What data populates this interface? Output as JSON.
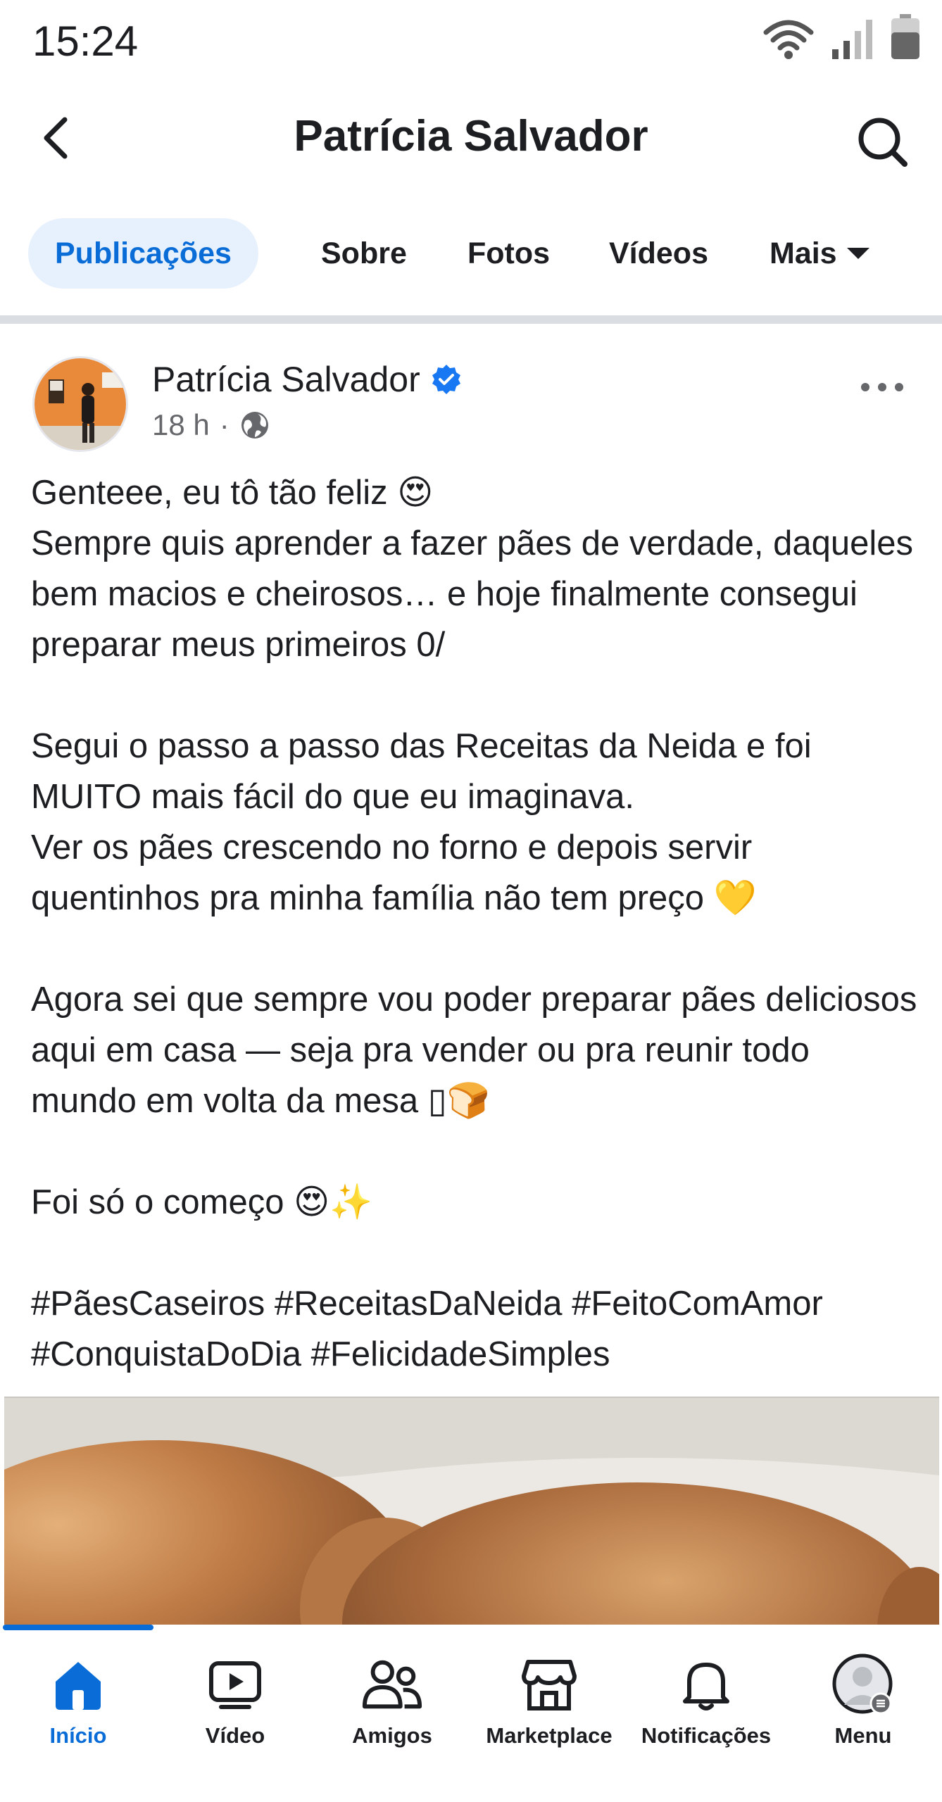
{
  "status_bar": {
    "time": "15:24"
  },
  "header": {
    "title": "Patrícia Salvador"
  },
  "tabs": [
    {
      "label": "Publicações",
      "active": true
    },
    {
      "label": "Sobre",
      "active": false
    },
    {
      "label": "Fotos",
      "active": false
    },
    {
      "label": "Vídeos",
      "active": false
    },
    {
      "label": "Mais",
      "active": false
    }
  ],
  "post": {
    "author": "Patrícia Salvador",
    "verified": true,
    "time": "18 h",
    "separator": "·",
    "audience_icon": "globe-icon",
    "paragraphs": [
      [
        "Genteee, eu tô tão feliz 😍",
        "Sempre quis aprender a fazer pães de verdade, daqueles bem macios e cheirosos… e hoje finalmente consegui preparar meus primeiros 0/"
      ],
      [
        "Segui o passo a passo das Receitas da Neida e foi MUITO mais fácil do que eu imaginava.",
        "Ver os pães crescendo no forno e depois servir quentinhos pra minha família não tem preço 💛"
      ],
      [
        "Agora sei que sempre vou poder preparar pães deliciosos aqui em casa — seja pra vender ou pra reunir todo mundo em volta da mesa ▯🍞"
      ],
      [
        "Foi só o começo 😍✨"
      ],
      [
        "#PãesCaseiros #ReceitasDaNeida #FeitoComAmor #ConquistaDoDia #FelicidadeSimples"
      ]
    ]
  },
  "bottom_nav": [
    {
      "label": "Início",
      "icon": "home-icon",
      "active": true
    },
    {
      "label": "Vídeo",
      "icon": "video-icon",
      "active": false
    },
    {
      "label": "Amigos",
      "icon": "friends-icon",
      "active": false
    },
    {
      "label": "Marketplace",
      "icon": "marketplace-icon",
      "active": false
    },
    {
      "label": "Notificações",
      "icon": "bell-icon",
      "active": false
    },
    {
      "label": "Menu",
      "icon": "avatar-icon",
      "active": false
    }
  ],
  "colors": {
    "accent": "#0a6cd6",
    "active_tab_bg": "#e7f1fd",
    "text": "#1c1e21",
    "secondary_text": "#65676b",
    "divider": "#dadde1"
  }
}
